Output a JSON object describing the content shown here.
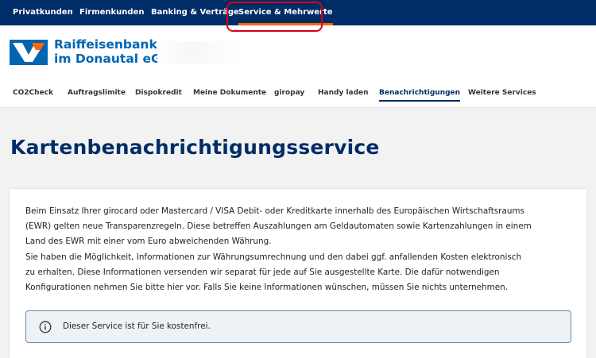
{
  "topnav": {
    "items": [
      {
        "label": "Privatkunden"
      },
      {
        "label": "Firmenkunden"
      },
      {
        "label": "Banking & Verträge"
      },
      {
        "label": "Service & Mehrwerte"
      }
    ],
    "active_index": 3,
    "highlight_color": "#d6001c"
  },
  "brand": {
    "name_line1": "Raiffeisenbank",
    "name_line2": "im Donautal eG",
    "icon": "volksbank-raiffeisenbank-logo-icon",
    "colors": {
      "blue": "#0066b3",
      "orange": "#ff6600"
    }
  },
  "subnav": {
    "items": [
      {
        "label": "CO2Check"
      },
      {
        "label": "Auftragslimite"
      },
      {
        "label": "Dispokredit"
      },
      {
        "label": "Meine Dokumente"
      },
      {
        "label": "giropay"
      },
      {
        "label": "Handy laden"
      },
      {
        "label": "Benachrichtigungen"
      },
      {
        "label": "Weitere Services"
      }
    ],
    "active_index": 6
  },
  "main": {
    "title": "Kartenbenachrichtigungsservice",
    "body_lines": [
      "Beim Einsatz Ihrer girocard oder Mastercard / VISA Debit- oder Kreditkarte innerhalb des Europäischen Wirtschaftsraums",
      "(EWR) gelten neue Transparenzregeln. Diese betreffen Auszahlungen am Geldautomaten sowie Kartenzahlungen in einem",
      "Land des EWR mit einer vom Euro abweichenden Währung.",
      "Sie haben die Möglichkeit, Informationen zur Währungsumrechnung und den dabei ggf. anfallenden Kosten elektronisch",
      "zu erhalten. Diese Informationen versenden wir separat für jede auf Sie ausgestellte Karte. Die dafür notwendigen",
      "Konfigurationen nehmen Sie bitte hier vor. Falls Sie keine Informationen wünschen, müssen Sie nichts unternehmen."
    ],
    "info_box": {
      "icon": "info-icon",
      "text": "Dieser Service ist für Sie kostenfrei."
    }
  },
  "colors": {
    "navy": "#002d67",
    "accent_orange": "#ff6600",
    "page_bg": "#f2f2f2"
  }
}
